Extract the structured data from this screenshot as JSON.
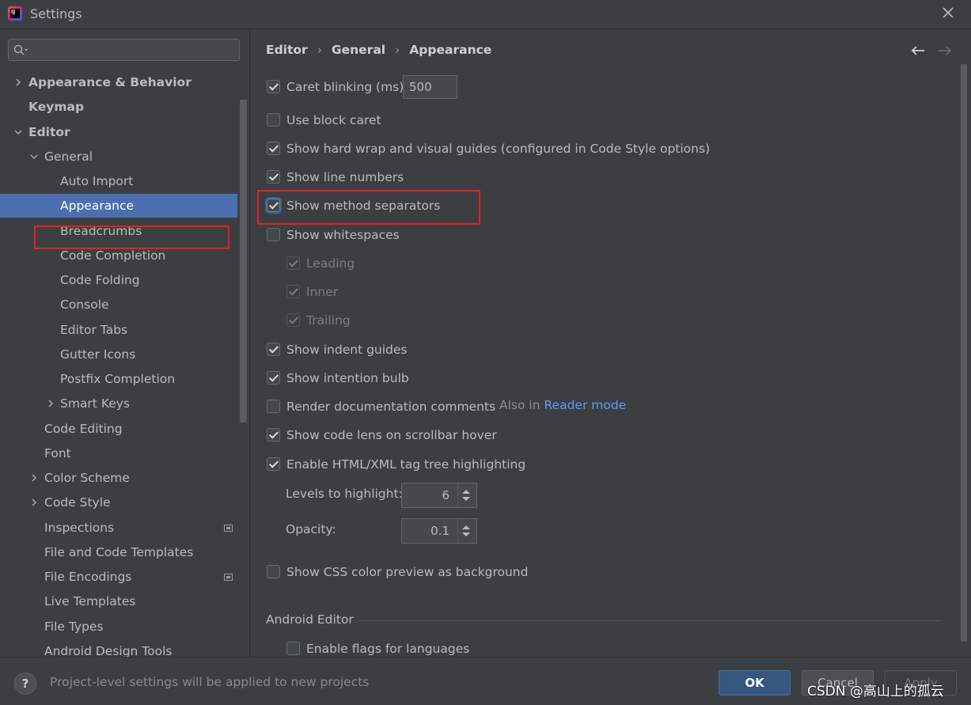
{
  "window": {
    "title": "Settings"
  },
  "search": {
    "placeholder": ""
  },
  "sidebar": {
    "items": [
      {
        "label": "Appearance & Behavior"
      },
      {
        "label": "Keymap"
      },
      {
        "label": "Editor"
      },
      {
        "label": "General"
      },
      {
        "label": "Auto Import"
      },
      {
        "label": "Appearance"
      },
      {
        "label": "Breadcrumbs"
      },
      {
        "label": "Code Completion"
      },
      {
        "label": "Code Folding"
      },
      {
        "label": "Console"
      },
      {
        "label": "Editor Tabs"
      },
      {
        "label": "Gutter Icons"
      },
      {
        "label": "Postfix Completion"
      },
      {
        "label": "Smart Keys"
      },
      {
        "label": "Code Editing"
      },
      {
        "label": "Font"
      },
      {
        "label": "Color Scheme"
      },
      {
        "label": "Code Style"
      },
      {
        "label": "Inspections"
      },
      {
        "label": "File and Code Templates"
      },
      {
        "label": "File Encodings"
      },
      {
        "label": "Live Templates"
      },
      {
        "label": "File Types"
      },
      {
        "label": "Android Design Tools"
      }
    ]
  },
  "breadcrumb": {
    "part1": "Editor",
    "part2": "General",
    "part3": "Appearance",
    "sep": "›"
  },
  "options": {
    "caret_blinking": {
      "label": "Caret blinking (ms):",
      "value": "500",
      "checked": true
    },
    "block_caret": {
      "label": "Use block caret",
      "checked": false
    },
    "hard_wrap": {
      "label": "Show hard wrap and visual guides (configured in Code Style options)",
      "checked": true
    },
    "line_numbers": {
      "label": "Show line numbers",
      "checked": true
    },
    "method_separators": {
      "label": "Show method separators",
      "checked": true
    },
    "whitespaces": {
      "label": "Show whitespaces",
      "checked": false
    },
    "leading": {
      "label": "Leading",
      "checked": true
    },
    "inner": {
      "label": "Inner",
      "checked": true
    },
    "trailing": {
      "label": "Trailing",
      "checked": true
    },
    "indent_guides": {
      "label": "Show indent guides",
      "checked": true
    },
    "intention_bulb": {
      "label": "Show intention bulb",
      "checked": true
    },
    "render_docs": {
      "label": "Render documentation comments",
      "checked": false,
      "hint": "Also in",
      "hint_link": "Reader mode"
    },
    "code_lens": {
      "label": "Show code lens on scrollbar hover",
      "checked": true
    },
    "tag_tree": {
      "label": "Enable HTML/XML tag tree highlighting",
      "checked": true
    },
    "levels": {
      "label": "Levels to highlight:",
      "value": "6"
    },
    "opacity": {
      "label": "Opacity:",
      "value": "0.1"
    },
    "css_preview": {
      "label": "Show CSS color preview as background",
      "checked": false
    }
  },
  "android_section": {
    "title": "Android Editor",
    "flags": {
      "label": "Enable flags for languages",
      "checked": false
    }
  },
  "footer": {
    "help": "?",
    "note": "Project-level settings will be applied to new projects",
    "ok": "OK",
    "cancel": "Cancel",
    "apply": "Apply"
  },
  "watermark": "CSDN @高山上的孤云",
  "colors": {
    "accent": "#4b6eaf",
    "highlight_box": "#e0202a",
    "ok_button": "#365880",
    "link": "#589df6"
  }
}
